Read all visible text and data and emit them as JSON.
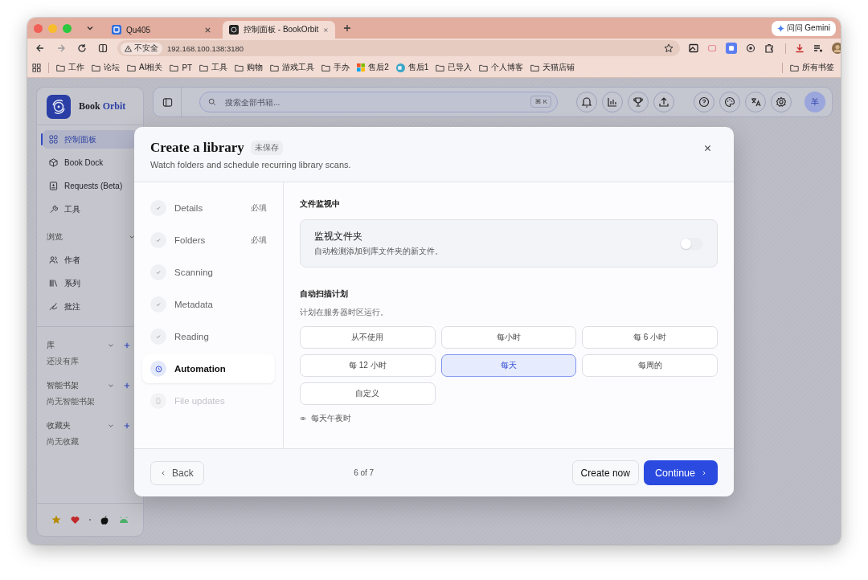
{
  "browser": {
    "tabs": [
      {
        "title": "Qu405",
        "selected": false
      },
      {
        "title": "控制面板 - BookOrbit",
        "selected": true
      }
    ],
    "gemini": "问问 Gemini",
    "address": {
      "security": "不安全",
      "url": "192.168.100.138:3180"
    },
    "bookmarks": [
      {
        "label": "工作",
        "kind": "folder"
      },
      {
        "label": "论坛",
        "kind": "folder"
      },
      {
        "label": "AI相关",
        "kind": "folder"
      },
      {
        "label": "PT",
        "kind": "folder"
      },
      {
        "label": "工具",
        "kind": "folder"
      },
      {
        "label": "购物",
        "kind": "folder"
      },
      {
        "label": "游戏工具",
        "kind": "folder"
      },
      {
        "label": "手办",
        "kind": "folder"
      },
      {
        "label": "售后2",
        "kind": "tiles"
      },
      {
        "label": "售后1",
        "kind": "globe"
      },
      {
        "label": "已导入",
        "kind": "folder"
      },
      {
        "label": "个人博客",
        "kind": "folder"
      },
      {
        "label": "天猫店铺",
        "kind": "folder"
      }
    ],
    "all_bookmarks": "所有书签"
  },
  "sidebar": {
    "brand": {
      "first": "Book",
      "second": "Orbit"
    },
    "nav": [
      {
        "label": "控制面板",
        "selected": true
      },
      {
        "label": "Book Dock",
        "selected": false
      },
      {
        "label": "Requests (Beta)",
        "selected": false
      },
      {
        "label": "工具",
        "selected": false
      }
    ],
    "browse": {
      "title": "浏览",
      "items": [
        {
          "label": "作者"
        },
        {
          "label": "系列"
        },
        {
          "label": "批注"
        }
      ]
    },
    "sections": [
      {
        "title": "库",
        "empty": "还没有库"
      },
      {
        "title": "智能书架",
        "empty": "尚无智能书架"
      },
      {
        "title": "收藏夹",
        "empty": "尚无收藏"
      }
    ]
  },
  "topbar": {
    "search_placeholder": "搜索全部书籍...",
    "shortcut": "⌘ K",
    "avatar": "羊"
  },
  "modal": {
    "title": "Create a library",
    "badge": "未保存",
    "subtitle": "Watch folders and schedule recurring library scans.",
    "steps": [
      {
        "label": "Details",
        "done": true,
        "selected": false,
        "disabled": false,
        "tag": "必填"
      },
      {
        "label": "Folders",
        "done": true,
        "selected": false,
        "disabled": false,
        "tag": "必填"
      },
      {
        "label": "Scanning",
        "done": true,
        "selected": false,
        "disabled": false
      },
      {
        "label": "Metadata",
        "done": true,
        "selected": false,
        "disabled": false
      },
      {
        "label": "Reading",
        "done": true,
        "selected": false,
        "disabled": false
      },
      {
        "label": "Automation",
        "done": false,
        "selected": true,
        "disabled": false
      },
      {
        "label": "File updates",
        "done": false,
        "selected": false,
        "disabled": true
      }
    ],
    "watch_heading": "文件监视中",
    "watch": {
      "title": "监视文件夹",
      "description": "自动检测添加到库文件夹的新文件。",
      "on": false
    },
    "schedule_heading": "自动扫描计划",
    "schedule_hint": "计划在服务器时区运行。",
    "options": [
      {
        "label": "从不使用",
        "selected": false
      },
      {
        "label": "每小时",
        "selected": false
      },
      {
        "label": "每 6 小时",
        "selected": false
      },
      {
        "label": "每 12 小时",
        "selected": false
      },
      {
        "label": "每天",
        "selected": true
      },
      {
        "label": "每周的",
        "selected": false
      },
      {
        "label": "自定义",
        "selected": false
      }
    ],
    "preview": "每天午夜时",
    "back": "Back",
    "progress": "6 of 7",
    "create": "Create now",
    "continue": "Continue"
  }
}
